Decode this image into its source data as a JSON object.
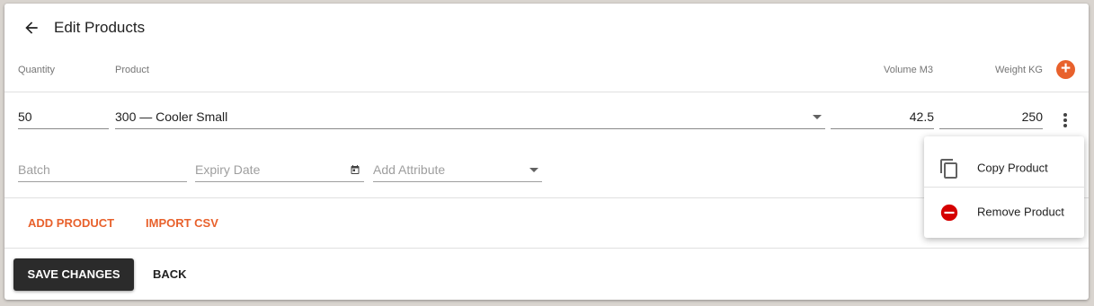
{
  "header": {
    "title": "Edit Products"
  },
  "columns": {
    "quantity": "Quantity",
    "product": "Product",
    "volume": "Volume M3",
    "weight": "Weight KG"
  },
  "row": {
    "quantity": "50",
    "product": "300 — Cooler Small",
    "volume": "42.5",
    "weight": "250",
    "batch_placeholder": "Batch",
    "expiry_placeholder": "Expiry Date",
    "attribute_placeholder": "Add Attribute"
  },
  "actions": {
    "add_product": "ADD PRODUCT",
    "import_csv": "IMPORT CSV"
  },
  "footer": {
    "save": "SAVE CHANGES",
    "back": "BACK"
  },
  "menu": {
    "items": [
      {
        "label": "Copy Product",
        "icon": "copy-icon"
      },
      {
        "label": "Remove Product",
        "icon": "remove-circle-icon"
      }
    ]
  },
  "colors": {
    "accent": "#e8612c",
    "remove": "#d50000",
    "primary_button": "#2b2b2b"
  }
}
